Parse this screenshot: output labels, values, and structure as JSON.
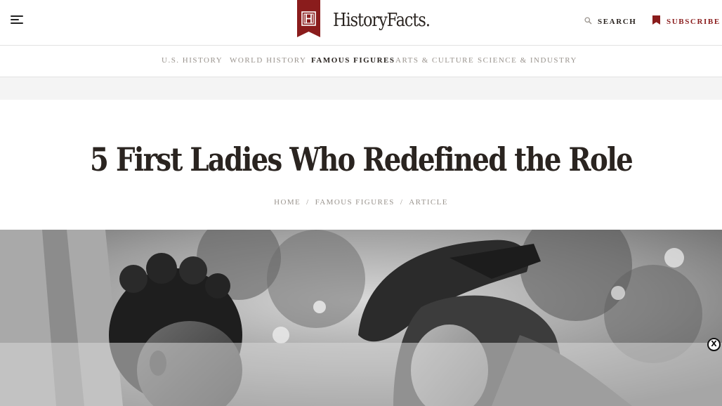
{
  "header": {
    "logo_text": "HistoryFacts.",
    "search_label": "SEARCH",
    "subscribe_label": "SUBSCRIBE",
    "brand_color": "#8a1c1c"
  },
  "nav": {
    "items": [
      {
        "label": "U.S. HISTORY",
        "active": false
      },
      {
        "label": "WORLD HISTORY",
        "active": false
      },
      {
        "label": "FAMOUS FIGURES",
        "active": true
      },
      {
        "label": "ARTS & CULTURE",
        "active": false
      },
      {
        "label": "SCIENCE & INDUSTRY",
        "active": false
      }
    ]
  },
  "article": {
    "title": "5 First Ladies Who Redefined the Role",
    "breadcrumb": [
      "HOME",
      "FAMOUS FIGURES",
      "ARTICLE"
    ],
    "separator": "/"
  },
  "ad": {
    "close_label": "X"
  },
  "icons": {
    "menu": "hamburger-menu-icon",
    "search": "search-icon",
    "subscribe": "bookmark-icon",
    "logo": "history-facts-logo-icon"
  }
}
